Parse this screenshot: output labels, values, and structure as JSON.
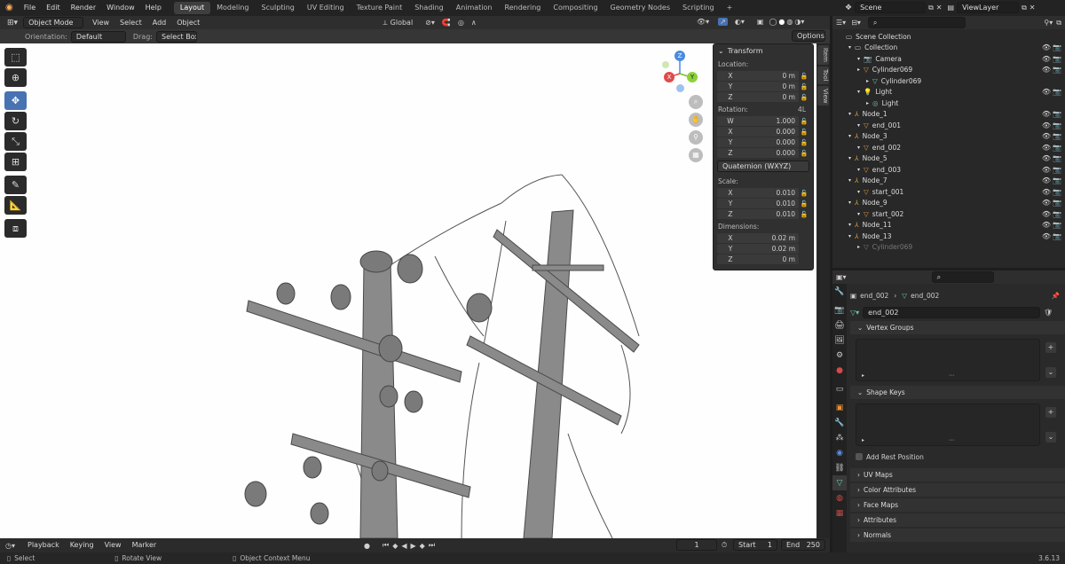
{
  "topbar": {
    "menus": [
      "File",
      "Edit",
      "Render",
      "Window",
      "Help"
    ],
    "workspaces": [
      "Layout",
      "Modeling",
      "Sculpting",
      "UV Editing",
      "Texture Paint",
      "Shading",
      "Animation",
      "Rendering",
      "Compositing",
      "Geometry Nodes",
      "Scripting"
    ],
    "active_workspace": "Layout",
    "add_tab": "+",
    "scene": "Scene",
    "view_layer": "ViewLayer"
  },
  "viewport_header": {
    "mode": "Object Mode",
    "menus": [
      "View",
      "Select",
      "Add",
      "Object"
    ],
    "transform_orientation": "Global",
    "orientation_label": "Orientation:",
    "orientation_value": "Default",
    "drag_label": "Drag:",
    "drag_value": "Select Box",
    "options": "Options"
  },
  "gizmo": {
    "z": "Z",
    "y": "Y",
    "x": "X"
  },
  "transform_panel": {
    "title": "Transform",
    "location_label": "Location:",
    "location": [
      {
        "axis": "X",
        "value": "0 m"
      },
      {
        "axis": "Y",
        "value": "0 m"
      },
      {
        "axis": "Z",
        "value": "0 m"
      }
    ],
    "rotation_label": "Rotation:",
    "rotation_mode_badge": "4L",
    "rotation": [
      {
        "axis": "W",
        "value": "1.000"
      },
      {
        "axis": "X",
        "value": "0.000"
      },
      {
        "axis": "Y",
        "value": "0.000"
      },
      {
        "axis": "Z",
        "value": "0.000"
      }
    ],
    "rotation_mode": "Quaternion (WXYZ)",
    "scale_label": "Scale:",
    "scale": [
      {
        "axis": "X",
        "value": "0.010"
      },
      {
        "axis": "Y",
        "value": "0.010"
      },
      {
        "axis": "Z",
        "value": "0.010"
      }
    ],
    "dimensions_label": "Dimensions:",
    "dimensions": [
      {
        "axis": "X",
        "value": "0.02 m"
      },
      {
        "axis": "Y",
        "value": "0.02 m"
      },
      {
        "axis": "Z",
        "value": "0 m"
      }
    ]
  },
  "side_tabs": [
    "Item",
    "Tool",
    "View"
  ],
  "outliner": {
    "rows": [
      {
        "label": "Scene Collection",
        "indent": 0,
        "icon": "collection-icon",
        "color": "#cccccc",
        "vis": false
      },
      {
        "label": "Collection",
        "indent": 1,
        "icon": "collection-icon",
        "color": "#cccccc",
        "vis": true
      },
      {
        "label": "Camera",
        "indent": 2,
        "icon": "camera-icon",
        "color": "#d89a4a",
        "vis": true
      },
      {
        "label": "Cylinder069",
        "indent": 2,
        "icon": "object-icon",
        "color": "#d89a4a",
        "vis": true
      },
      {
        "label": "Cylinder069",
        "indent": 3,
        "icon": "mesh-icon",
        "color": "#6fc6a8",
        "vis": false
      },
      {
        "label": "Light",
        "indent": 2,
        "icon": "light-icon",
        "color": "#d89a4a",
        "vis": true
      },
      {
        "label": "Light",
        "indent": 3,
        "icon": "light-data-icon",
        "color": "#6fc6a8",
        "vis": false
      },
      {
        "label": "Node_1",
        "indent": 1,
        "icon": "empty-icon",
        "color": "#d89a4a",
        "vis": true
      },
      {
        "label": "end_001",
        "indent": 2,
        "icon": "object-icon",
        "color": "#d89a4a",
        "vis": true
      },
      {
        "label": "Node_3",
        "indent": 1,
        "icon": "empty-icon",
        "color": "#d89a4a",
        "vis": true
      },
      {
        "label": "end_002",
        "indent": 2,
        "icon": "object-icon",
        "color": "#d89a4a",
        "vis": true
      },
      {
        "label": "Node_5",
        "indent": 1,
        "icon": "empty-icon",
        "color": "#d89a4a",
        "vis": true
      },
      {
        "label": "end_003",
        "indent": 2,
        "icon": "object-icon",
        "color": "#d89a4a",
        "vis": true
      },
      {
        "label": "Node_7",
        "indent": 1,
        "icon": "empty-icon",
        "color": "#d89a4a",
        "vis": true
      },
      {
        "label": "start_001",
        "indent": 2,
        "icon": "object-icon",
        "color": "#d89a4a",
        "vis": true
      },
      {
        "label": "Node_9",
        "indent": 1,
        "icon": "empty-icon",
        "color": "#d89a4a",
        "vis": true
      },
      {
        "label": "start_002",
        "indent": 2,
        "icon": "object-icon",
        "color": "#d89a4a",
        "vis": true
      },
      {
        "label": "Node_11",
        "indent": 1,
        "icon": "empty-icon",
        "color": "#d89a4a",
        "vis": true
      },
      {
        "label": "Node_13",
        "indent": 1,
        "icon": "empty-icon",
        "color": "#d89a4a",
        "vis": true
      },
      {
        "label": "Cylinder069",
        "indent": 2,
        "icon": "object-icon",
        "color": "#777777",
        "vis": false
      }
    ]
  },
  "properties": {
    "breadcrumb_object": "end_002",
    "breadcrumb_data": "end_002",
    "data_name": "end_002",
    "sections": {
      "vertex_groups": "Vertex Groups",
      "shape_keys": "Shape Keys",
      "add_rest_position": "Add Rest Position",
      "uv_maps": "UV Maps",
      "color_attributes": "Color Attributes",
      "face_maps": "Face Maps",
      "attributes": "Attributes",
      "normals": "Normals"
    }
  },
  "timeline": {
    "menus": [
      "Playback",
      "Keying",
      "View",
      "Marker"
    ],
    "current_frame": "1",
    "start_label": "Start",
    "start": "1",
    "end_label": "End",
    "end": "250"
  },
  "statusbar": {
    "select": "Select",
    "rotate": "Rotate View",
    "context": "Object Context Menu",
    "version": "3.6.13"
  }
}
